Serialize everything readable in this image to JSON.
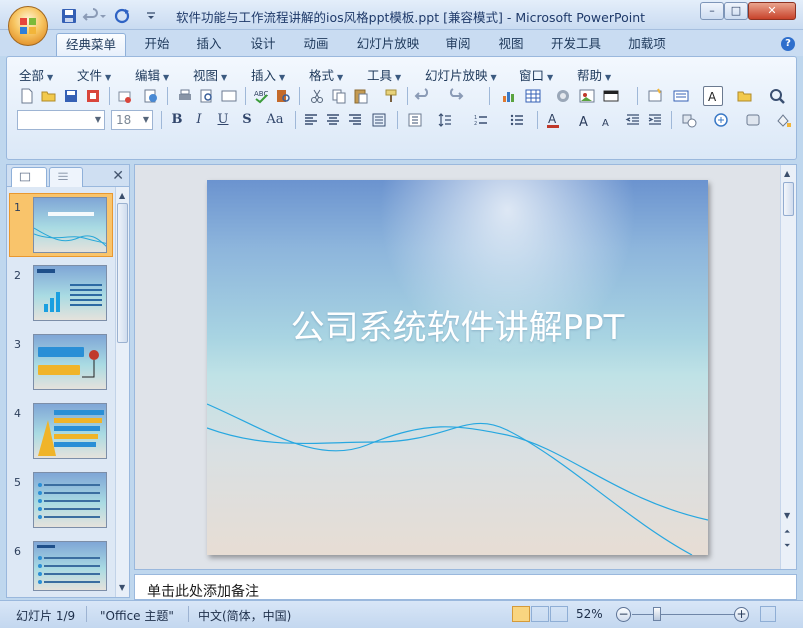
{
  "window": {
    "title": "软件功能与工作流程讲解的ios风格ppt模板.ppt [兼容模式] - Microsoft PowerPoint",
    "minimize_label": "–",
    "maximize_label": "□",
    "close_label": "✕"
  },
  "ribbon": {
    "tabs": [
      {
        "label": "经典菜单",
        "active": true
      },
      {
        "label": "开始"
      },
      {
        "label": "插入"
      },
      {
        "label": "设计"
      },
      {
        "label": "动画"
      },
      {
        "label": "幻灯片放映"
      },
      {
        "label": "审阅"
      },
      {
        "label": "视图"
      },
      {
        "label": "开发工具"
      },
      {
        "label": "加载项"
      }
    ],
    "menus": [
      "全部",
      "文件",
      "编辑",
      "视图",
      "插入",
      "格式",
      "工具",
      "幻灯片放映",
      "窗口",
      "帮助"
    ],
    "font_name_value": "",
    "font_size_value": "18",
    "format_buttons": [
      "B",
      "I",
      "U",
      "S",
      "Aa"
    ]
  },
  "left_pane": {
    "slide_numbers": [
      "1",
      "2",
      "3",
      "4",
      "5",
      "6"
    ],
    "close_label": "✕"
  },
  "slide": {
    "title": "公司系统软件讲解PPT"
  },
  "notes": {
    "placeholder": "单击此处添加备注"
  },
  "status": {
    "slide_info": "幻灯片 1/9",
    "theme": "\"Office 主题\"",
    "language": "中文(简体，中国)",
    "zoom": "52%"
  },
  "colors": {
    "accent": "#1e395b",
    "selection": "#f9c46b",
    "ribbon_border": "#9ab8dd"
  }
}
